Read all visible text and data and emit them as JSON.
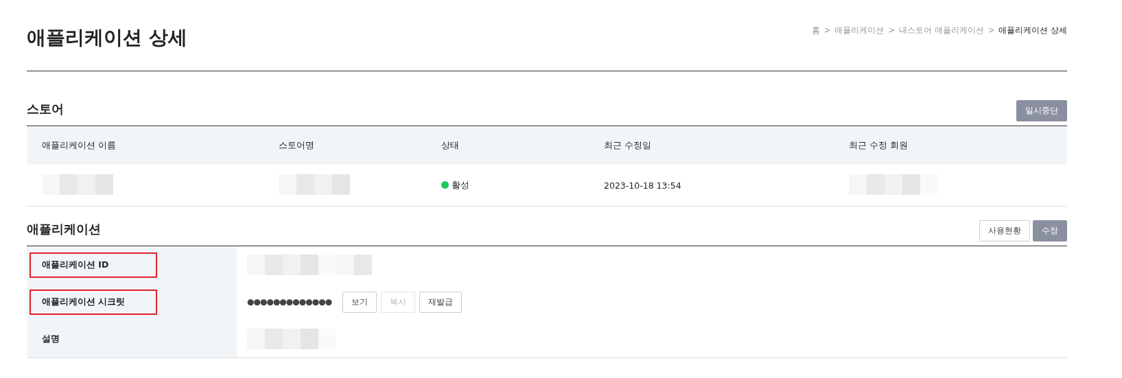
{
  "page": {
    "title": "애플리케이션 상세"
  },
  "breadcrumb": [
    {
      "label": "홈",
      "current": false
    },
    {
      "label": "애플리케이션",
      "current": false
    },
    {
      "label": "내스토어 애플리케이션",
      "current": false
    },
    {
      "label": "애플리케이션 상세",
      "current": true
    }
  ],
  "separator": ">",
  "store": {
    "heading": "스토어",
    "buttons": [
      {
        "label": "일시중단",
        "kind": "primary",
        "disabled": false
      }
    ],
    "columns": [
      "애플리케이션 이름",
      "스토어명",
      "상태",
      "최근 수정일",
      "최근 수정 회원"
    ],
    "rows": [
      [
        {
          "kind": "redacted"
        },
        {
          "kind": "redacted"
        },
        {
          "kind": "status",
          "text": "활성",
          "color": "#1ec85a"
        },
        {
          "kind": "text",
          "text": "2023-10-18 13:54"
        },
        {
          "kind": "redacted"
        }
      ]
    ]
  },
  "application": {
    "heading": "애플리케이션",
    "buttons": [
      {
        "label": "사용현황",
        "kind": "secondary",
        "disabled": false
      },
      {
        "label": "수정",
        "kind": "primary",
        "disabled": false
      }
    ],
    "fields": [
      {
        "label": "애플리케이션 ID",
        "highlighted": true,
        "kind": "redacted"
      },
      {
        "label": "애플리케이션 시크릿",
        "highlighted": true,
        "kind": "secret",
        "value": "●●●●●●●●●●●●●",
        "actions": [
          {
            "label": "보기",
            "disabled": false
          },
          {
            "label": "복사",
            "disabled": true
          },
          {
            "label": "재발급",
            "disabled": false
          }
        ]
      },
      {
        "label": "설명",
        "highlighted": false,
        "kind": "redacted"
      }
    ]
  }
}
